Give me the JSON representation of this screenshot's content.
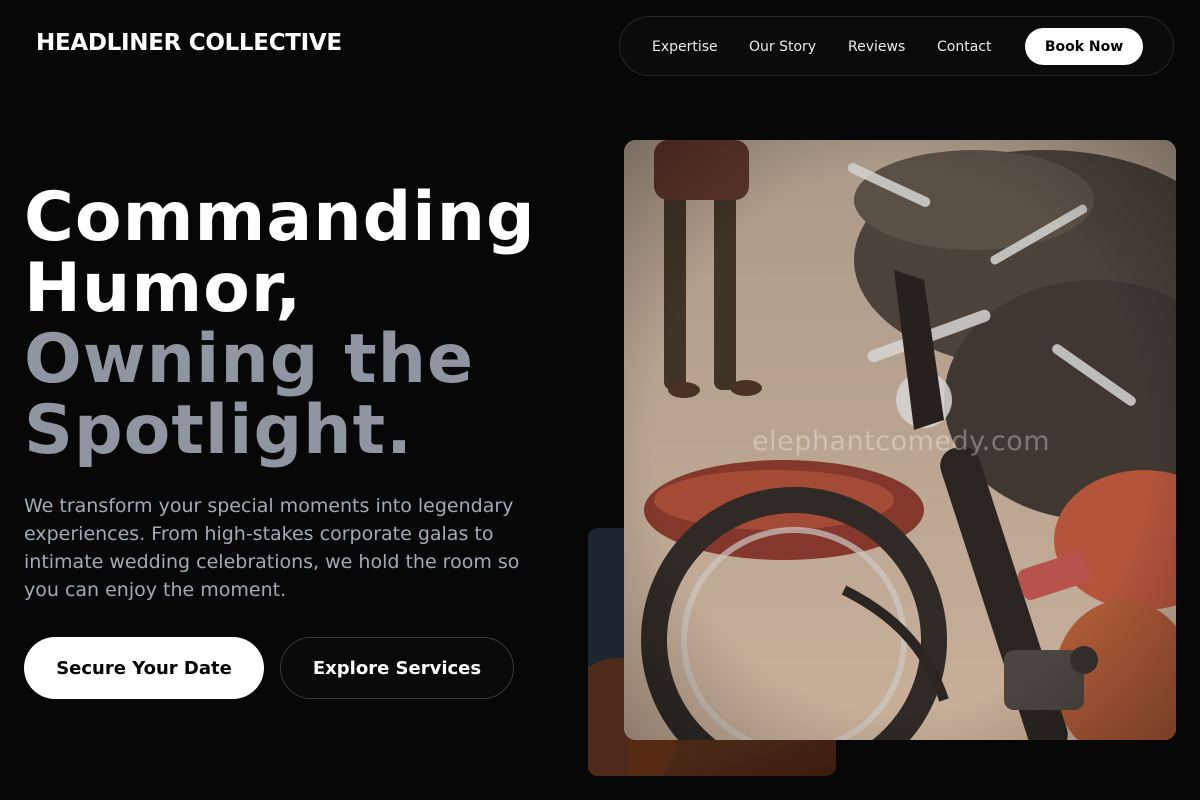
{
  "brand": {
    "name": "HEADLINER COLLECTIVE"
  },
  "nav": {
    "links": [
      "Expertise",
      "Our Story",
      "Reviews",
      "Contact"
    ],
    "cta": "Book Now"
  },
  "hero": {
    "headline_lines": [
      "Commanding",
      "Humor,",
      "Owning the",
      "Spotlight."
    ],
    "description": "We transform your special moments into legendary experiences. From high-stakes corporate galas to intimate wedding celebrations, we hold the room so you can enjoy the moment.",
    "primary_cta": "Secure Your Date",
    "secondary_cta": "Explore Services"
  },
  "media": {
    "main_image_subject": "motorcycle-handlebar-photo",
    "watermark": "elephantcomedy.com",
    "back_image_subject": "dark-stage-photo"
  },
  "colors": {
    "background": "#070707",
    "text_primary": "#ffffff",
    "text_muted": "#8f96a1",
    "button_bg": "#ffffff"
  }
}
